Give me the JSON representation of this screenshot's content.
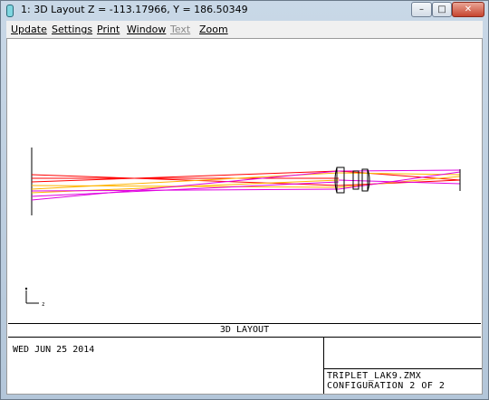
{
  "window": {
    "title": "1: 3D Layout Z = -113.17966, Y = 186.50349",
    "controls": {
      "minimize": "–",
      "maximize": "□",
      "close": "✕"
    }
  },
  "menu": [
    {
      "label": "Update",
      "enabled": true
    },
    {
      "label": "Settings",
      "enabled": true
    },
    {
      "label": "Print",
      "enabled": true
    },
    {
      "label": "Window",
      "enabled": true
    },
    {
      "label": "Text",
      "enabled": false
    },
    {
      "label": "Zoom",
      "enabled": true
    }
  ],
  "plot": {
    "caption": "3D LAYOUT",
    "date": "WED JUN 25 2014",
    "file": "TRIPLET_LAK9.ZMX",
    "configuration": "CONFIGURATION 2 OF 2",
    "axis_label": "z",
    "ray_colors": {
      "field1": "#ff0000",
      "field2": "#ffb400",
      "field3": "#e000e0"
    }
  }
}
